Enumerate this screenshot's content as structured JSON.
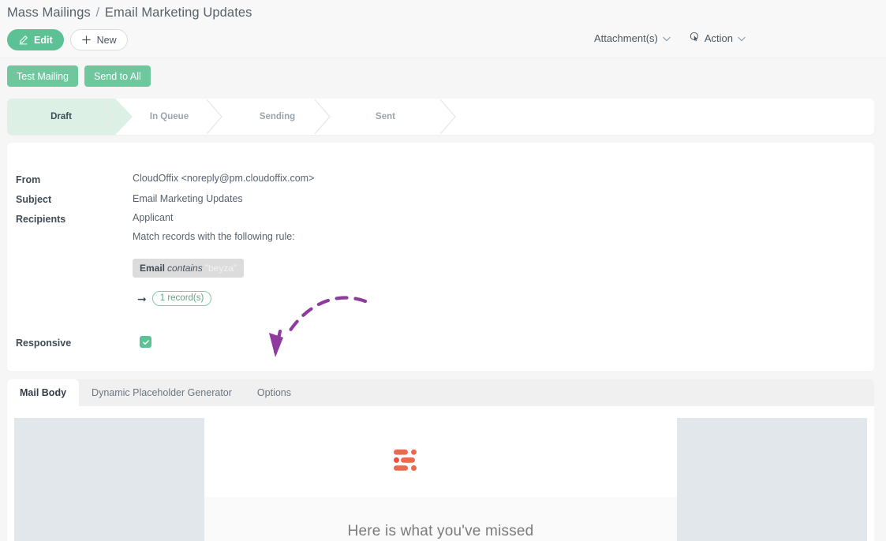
{
  "header": {
    "breadcrumb_root": "Mass Mailings",
    "breadcrumb_sep": "/",
    "breadcrumb_current": "Email Marketing Updates",
    "edit_label": "Edit",
    "new_label": "New",
    "attachments_label": "Attachment(s)",
    "action_label": "Action"
  },
  "actionbar": {
    "test_mailing_label": "Test Mailing",
    "send_to_all_label": "Send to All"
  },
  "pipeline": {
    "stages": [
      {
        "label": "Draft",
        "active": true
      },
      {
        "label": "In Queue",
        "active": false
      },
      {
        "label": "Sending",
        "active": false
      },
      {
        "label": "Sent",
        "active": false
      }
    ]
  },
  "detail": {
    "from_label": "From",
    "from_value": "CloudOffix <noreply@pm.cloudoffix.com>",
    "subject_label": "Subject",
    "subject_value": "Email Marketing Updates",
    "recipients_label": "Recipients",
    "recipients_value": "Applicant",
    "match_rule_text": "Match records with the following rule:",
    "rule": {
      "field": "Email",
      "operator": "contains",
      "value": "\"beyza\""
    },
    "record_count_label": "1 record(s)",
    "responsive_label": "Responsive",
    "responsive_checked": true
  },
  "tabs": [
    {
      "label": "Mail Body",
      "active": true
    },
    {
      "label": "Dynamic Placeholder Generator",
      "active": false
    },
    {
      "label": "Options",
      "active": false
    }
  ],
  "mail_preview": {
    "logo_name": "cloudoffix-logo",
    "headline": "Here is what you've missed"
  },
  "colors": {
    "brand_green": "#5cc194",
    "pill_green": "#6ec79d",
    "stage_active_bg": "#dcf0e6",
    "logo_orange": "#ea6a4b",
    "annotation_purple": "#8e3a9e",
    "panel_gray": "#e1e7ea",
    "chip_gray": "#dcdcdc"
  }
}
